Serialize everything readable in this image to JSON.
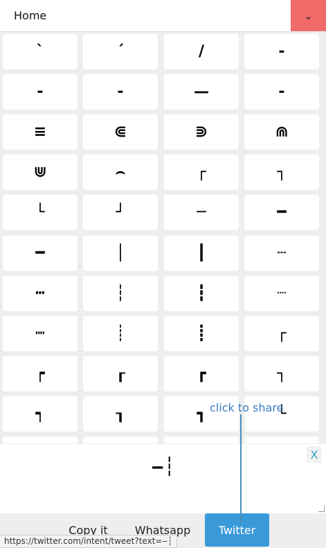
{
  "header": {
    "title": "Home",
    "toggle_icon": "⌄"
  },
  "tiles": [
    "ˋ",
    "ˊ",
    "/",
    "‐",
    "‐",
    "‐",
    "—",
    "‐",
    "≡",
    "⋐",
    "⋑",
    "⋒",
    "⋓",
    "⌢",
    "┌",
    "┐",
    "└",
    "┘",
    "─",
    "━",
    "━",
    "│",
    "┃",
    "┄",
    "┅",
    "┆",
    "┇",
    "┈",
    "┉",
    "┊",
    "┋",
    "┌",
    "┍",
    "┎",
    "┏",
    "┐",
    "┑",
    "┒",
    "┓",
    "└",
    "╵",
    "╵",
    "╵",
    "╵"
  ],
  "tooltip": "click to share",
  "preview": {
    "value": "‒┆",
    "close_label": "X"
  },
  "actions": {
    "copy": "Copy it",
    "whatsapp": "Whatsapp",
    "twitter": "Twitter"
  },
  "status_url": "https://twitter.com/intent/tweet?text=‒┆",
  "colors": {
    "toggle_bg": "#f06a6a",
    "twitter_bg": "#3a9ad9",
    "tooltip": "#3b7dc4"
  }
}
